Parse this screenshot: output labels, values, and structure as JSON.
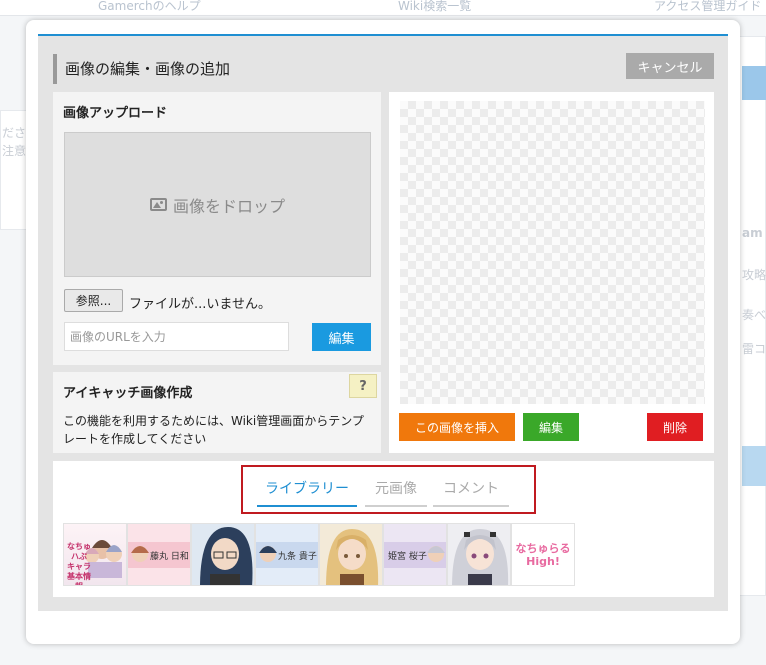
{
  "background": {
    "top_links": [
      "Gamerchのヘルプ",
      "Wiki検索一覧",
      "アクセス管理ガイド"
    ],
    "side_texts": [
      "ださ",
      "注意",
      "am",
      "攻略",
      "奏べ",
      "雷コ"
    ]
  },
  "modal": {
    "title": "画像の編集・画像の追加",
    "cancel_label": "キャンセル"
  },
  "upload": {
    "title": "画像アップロード",
    "drop_text": "画像をドロップ",
    "browse_label": "参照...",
    "file_status": "ファイルが...いません。",
    "url_placeholder": "画像のURLを入力",
    "edit_label": "編集"
  },
  "eyecatch": {
    "title": "アイキャッチ画像作成",
    "help_label": "?",
    "description": "この機能を利用するためには、Wiki管理画面からテンプレートを作成してください"
  },
  "preview": {
    "insert_label": "この画像を挿入",
    "edit_label": "編集",
    "delete_label": "削除"
  },
  "library": {
    "tabs": [
      {
        "label": "ライブラリー",
        "active": true
      },
      {
        "label": "元画像",
        "active": false
      },
      {
        "label": "コメント",
        "active": false
      }
    ],
    "thumbnails": [
      {
        "kind": "chibi-group",
        "text": "なちゅハぶ キャラ 基本情報"
      },
      {
        "kind": "name-banner",
        "text": "藤丸 日和"
      },
      {
        "kind": "portrait-dark-hair-glasses",
        "text": ""
      },
      {
        "kind": "name-banner",
        "text": "九条 貴子"
      },
      {
        "kind": "portrait-blonde",
        "text": ""
      },
      {
        "kind": "name-banner",
        "text": "姫宮 桜子"
      },
      {
        "kind": "portrait-silver-hair",
        "text": ""
      },
      {
        "kind": "logo",
        "text": "なちゅらる High!"
      }
    ]
  },
  "colors": {
    "accent_blue": "#1f8fd2",
    "insert_orange": "#f0780c",
    "edit_green": "#3aa829",
    "delete_red": "#e01e22",
    "highlight_red": "#c01a20"
  }
}
